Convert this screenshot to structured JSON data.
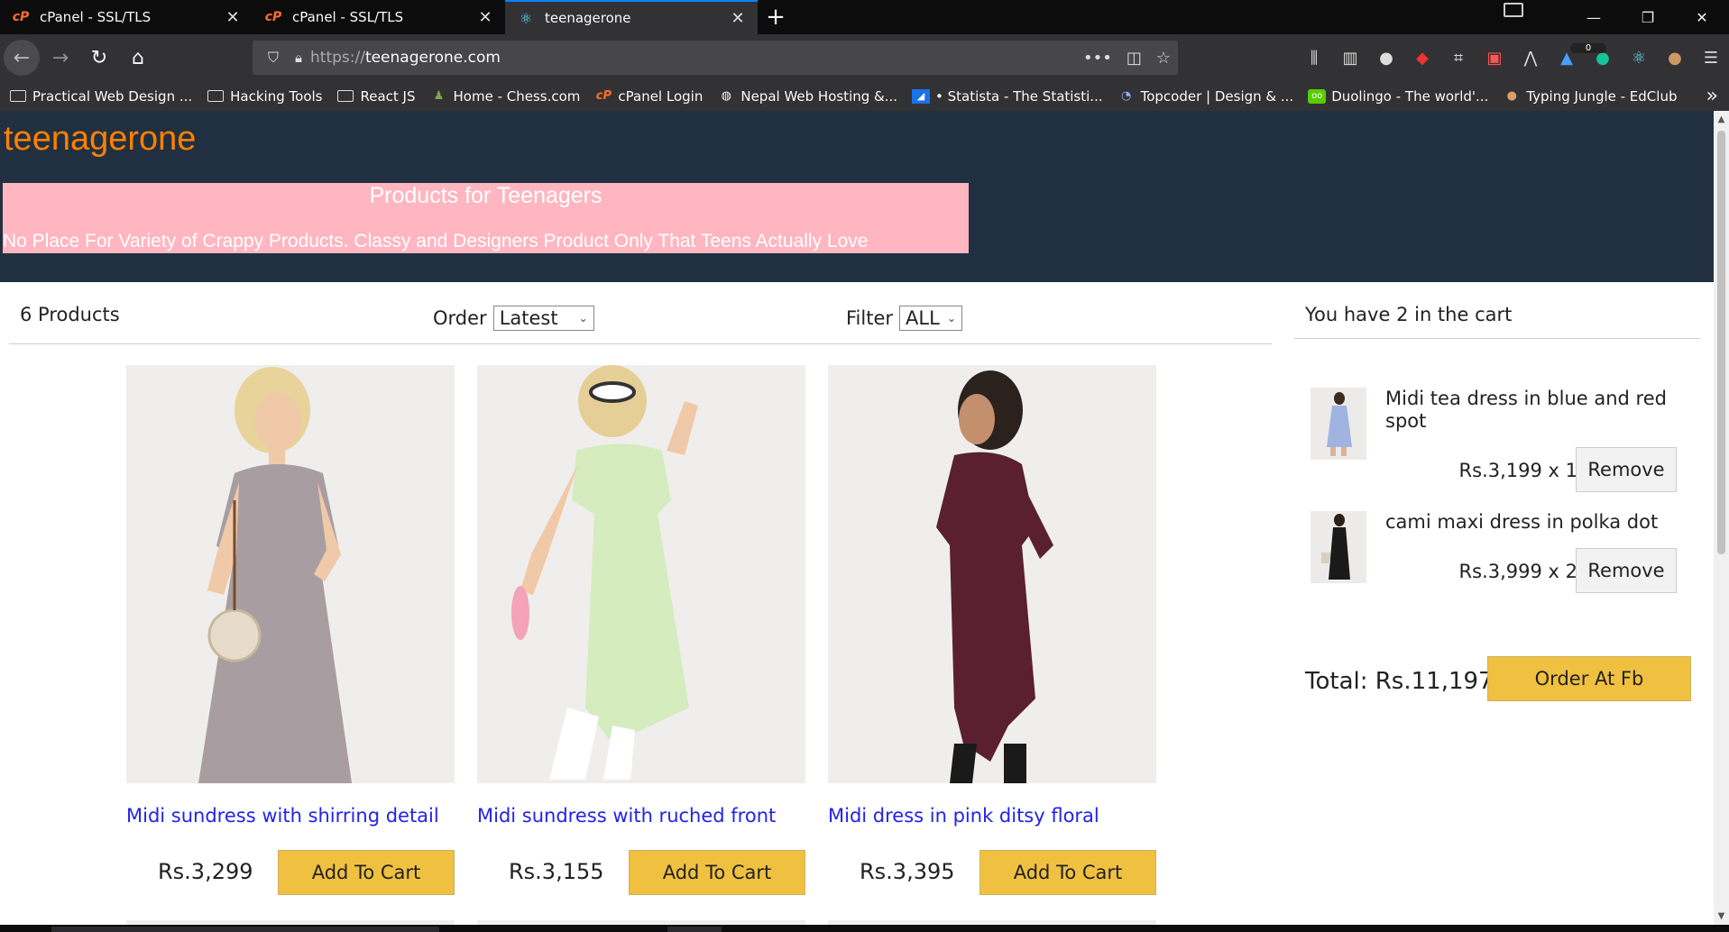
{
  "browser": {
    "tabs": [
      {
        "title": "cPanel - SSL/TLS",
        "favicon": "cpanel-icon",
        "active": false
      },
      {
        "title": "cPanel - SSL/TLS",
        "favicon": "cpanel-icon",
        "active": false
      },
      {
        "title": "teenagerone",
        "favicon": "react-icon",
        "active": true
      }
    ],
    "url_protocol": "https://",
    "url_host": "teenagerone.com",
    "url_menu": "•••",
    "bookmarks": [
      {
        "label": "Practical Web Design ...",
        "icon": "folder-icon"
      },
      {
        "label": "Hacking Tools",
        "icon": "folder-icon"
      },
      {
        "label": "React JS",
        "icon": "folder-icon"
      },
      {
        "label": "Home - Chess.com",
        "icon": "chess-icon"
      },
      {
        "label": "cPanel Login",
        "icon": "cpanel-icon"
      },
      {
        "label": "Nepal Web Hosting &...",
        "icon": "globe-icon"
      },
      {
        "label": "• Statista - The Statisti...",
        "icon": "statista-icon"
      },
      {
        "label": "Topcoder | Design & ...",
        "icon": "topcoder-icon"
      },
      {
        "label": "Duolingo - The world'...",
        "icon": "duolingo-icon"
      },
      {
        "label": "Typing Jungle - EdClub",
        "icon": "edclub-icon"
      }
    ],
    "extension_badge": "0"
  },
  "site": {
    "logo": "teenagerone",
    "banner_title": "Products for Teenagers",
    "banner_subtitle": "No Place For Variety of Crappy Products. Classy and Designers Product Only That Teens Actually Love",
    "colors": {
      "header_bg": "#203040",
      "logo": "#ff8000",
      "banner_bg": "#ffb6c1",
      "button": "#f0c040",
      "link": "#2222ee"
    }
  },
  "filters": {
    "count": "6 Products",
    "order_label": "Order",
    "order_value": "Latest",
    "filter_label": "Filter",
    "filter_value": "ALL"
  },
  "products": [
    {
      "name": "Midi sundress with shirring detail",
      "price": "Rs.3,299",
      "button": "Add To Cart"
    },
    {
      "name": "Midi sundress with ruched front",
      "price": "Rs.3,155",
      "button": "Add To Cart"
    },
    {
      "name": "Midi dress in pink ditsy floral",
      "price": "Rs.3,395",
      "button": "Add To Cart"
    }
  ],
  "cart": {
    "heading": "You have 2 in the cart",
    "items": [
      {
        "title": "Midi tea dress in blue and red spot",
        "qty_text": "Rs.3,199 x 1",
        "remove": "Remove"
      },
      {
        "title": "cami maxi dress in polka dot",
        "qty_text": "Rs.3,999 x 2",
        "remove": "Remove"
      }
    ],
    "total": "Total: Rs.11,197",
    "order_button": "Order At Fb"
  }
}
